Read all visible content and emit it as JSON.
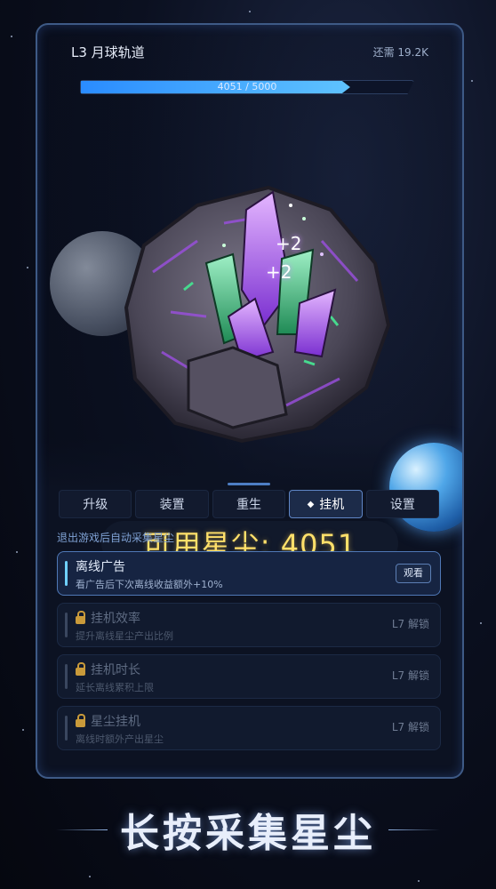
{
  "header": {
    "level_title": "L3 月球轨道",
    "need_label": "还需 19.2K",
    "progress_text": "4051 / 5000",
    "progress_fraction": 0.81
  },
  "scene": {
    "float_texts": [
      "+2",
      "+2"
    ],
    "stardust_label": "可用星尘: 4051"
  },
  "tabs": [
    {
      "label": "升级",
      "active": false
    },
    {
      "label": "装置",
      "active": false
    },
    {
      "label": "重生",
      "active": false
    },
    {
      "label": "挂机",
      "active": true,
      "icon": "diamond-icon"
    },
    {
      "label": "设置",
      "active": false
    }
  ],
  "panel": {
    "subtitle": "退出游戏后自动采集星尘",
    "items": [
      {
        "title": "离线广告",
        "desc": "看广告后下次离线收益额外+10%",
        "action": "观看",
        "locked": false
      },
      {
        "title": "挂机效率",
        "desc": "提升离线星尘产出比例",
        "status": "L7 解锁",
        "locked": true
      },
      {
        "title": "挂机时长",
        "desc": "延长离线累积上限",
        "status": "L7 解锁",
        "locked": true
      },
      {
        "title": "星尘挂机",
        "desc": "离线时额外产出星尘",
        "status": "L7 解锁",
        "locked": true
      }
    ]
  },
  "banner": {
    "text": "长按采集星尘"
  },
  "colors": {
    "accent": "#4f78b6",
    "stardust": "#ffe06a",
    "crystal_purple": "#b061ff",
    "crystal_green": "#3fd48a"
  }
}
